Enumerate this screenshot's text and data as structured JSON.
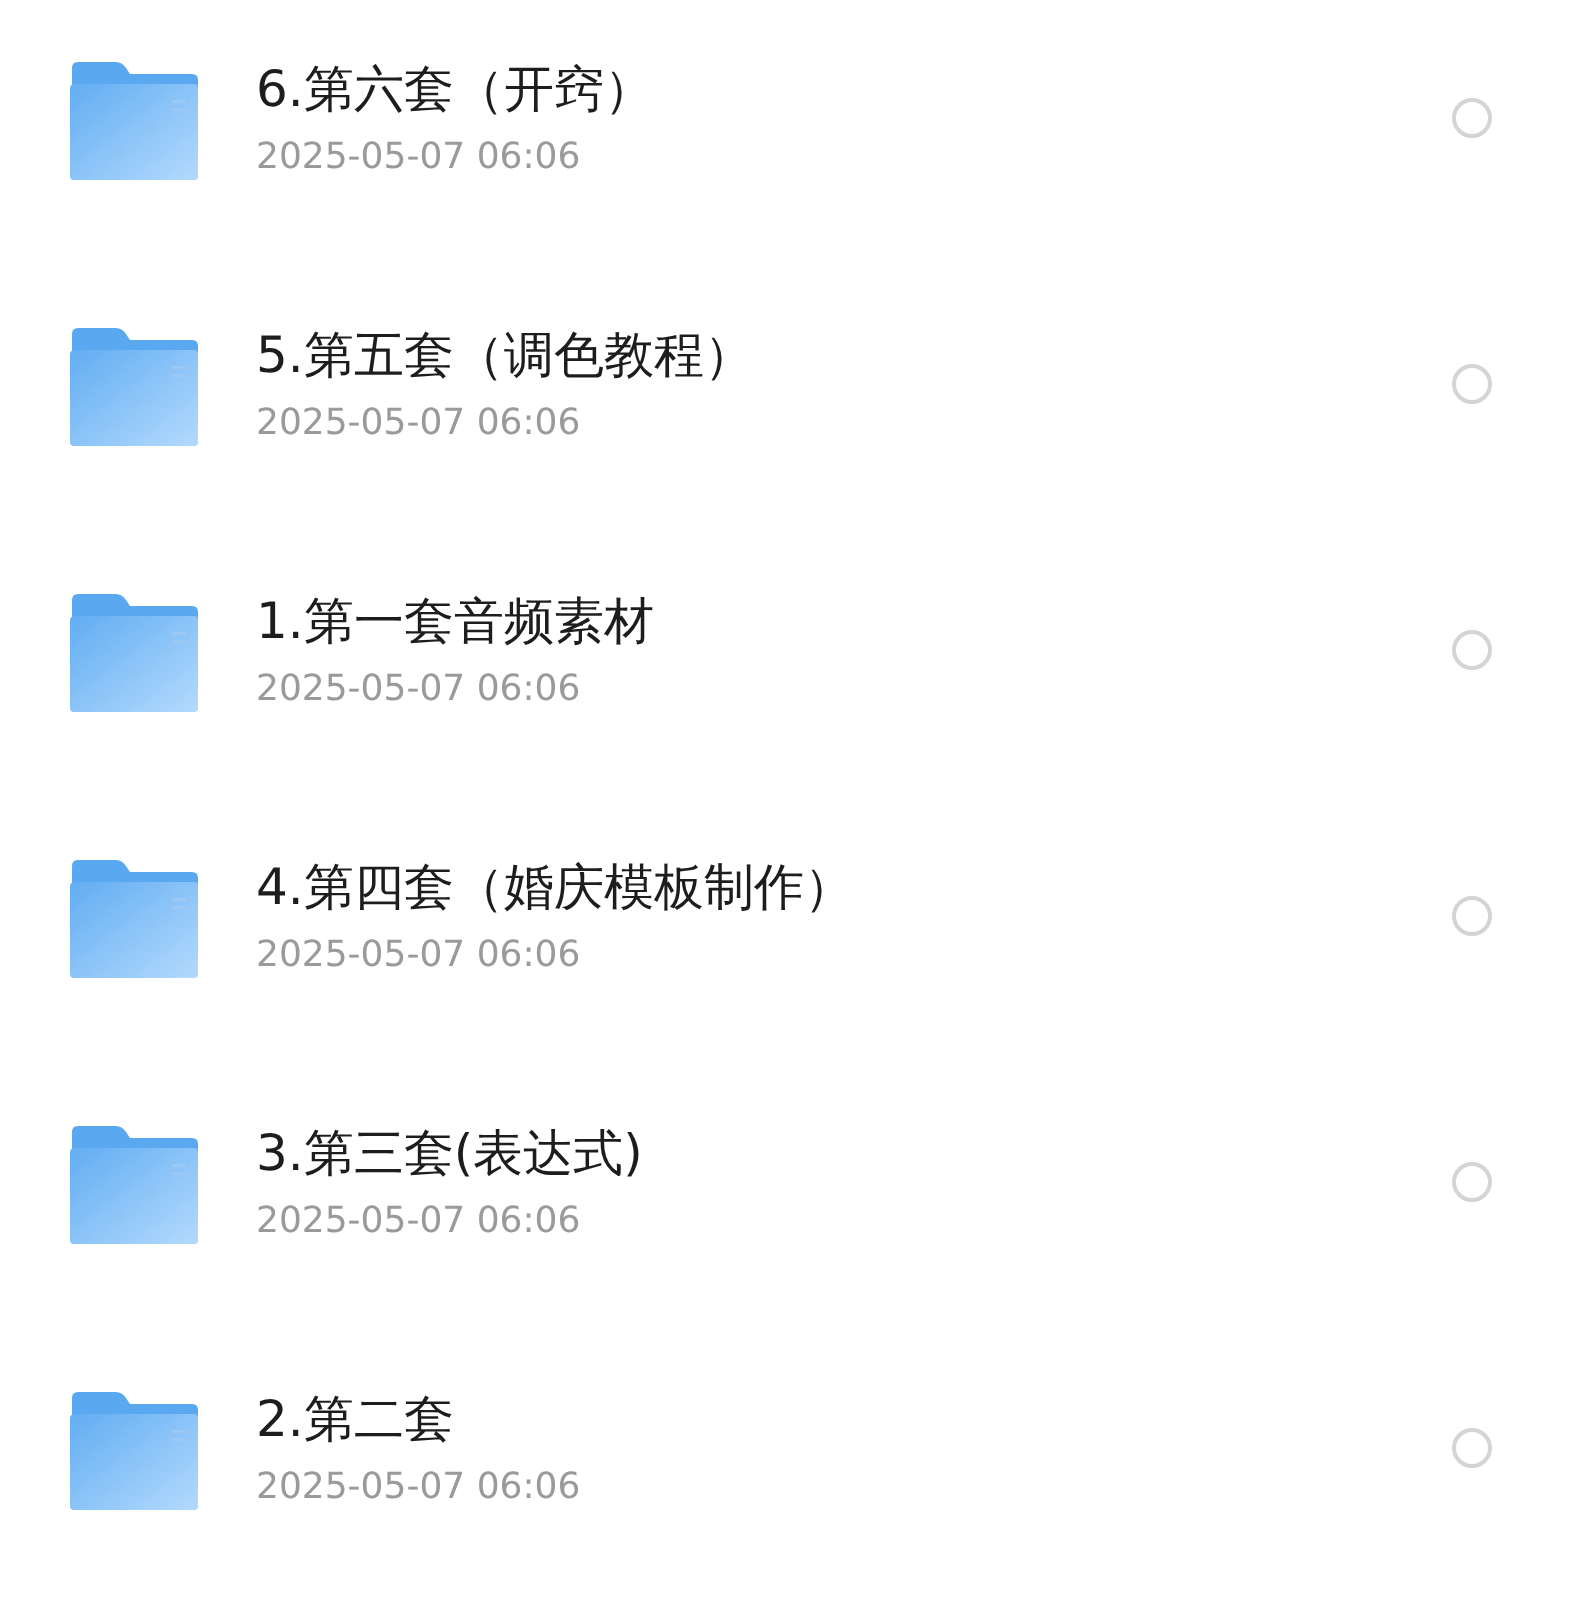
{
  "files": [
    {
      "name": "6.第六套（开窍）",
      "date": "2025-05-07 06:06",
      "selected": false
    },
    {
      "name": "5.第五套（调色教程）",
      "date": "2025-05-07 06:06",
      "selected": false
    },
    {
      "name": "1.第一套音频素材",
      "date": "2025-05-07 06:06",
      "selected": false
    },
    {
      "name": "4.第四套（婚庆模板制作）",
      "date": "2025-05-07 06:06",
      "selected": false
    },
    {
      "name": "3.第三套(表达式)",
      "date": "2025-05-07 06:06",
      "selected": false
    },
    {
      "name": "2.第二套",
      "date": "2025-05-07 06:06",
      "selected": false
    }
  ]
}
